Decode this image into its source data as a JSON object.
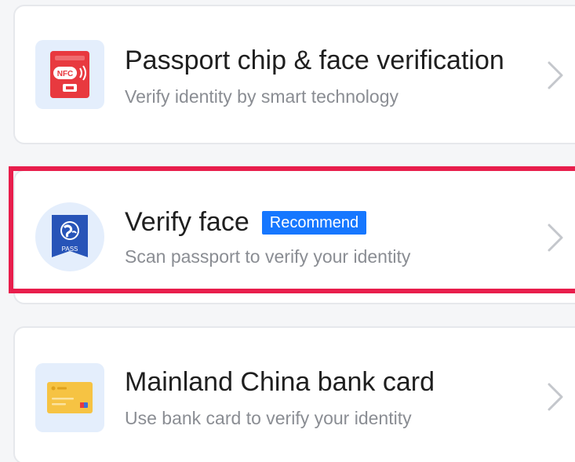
{
  "options": [
    {
      "title": "Passport chip & face verification",
      "subtitle": "Verify identity by smart technology",
      "icon": "nfc-passport-icon",
      "icon_text": "NFC"
    },
    {
      "title": "Verify face",
      "badge": "Recommend",
      "subtitle": "Scan passport to verify your identity",
      "icon": "passport-globe-icon",
      "icon_text": "PASS"
    },
    {
      "title": "Mainland China bank card",
      "subtitle": "Use bank card to verify your identity",
      "icon": "bank-card-icon"
    }
  ],
  "colors": {
    "accent": "#1677ff",
    "highlight": "#e81e4c",
    "nfc_red": "#e8393f",
    "passport_blue": "#2754b8",
    "card_yellow": "#f6c343"
  }
}
